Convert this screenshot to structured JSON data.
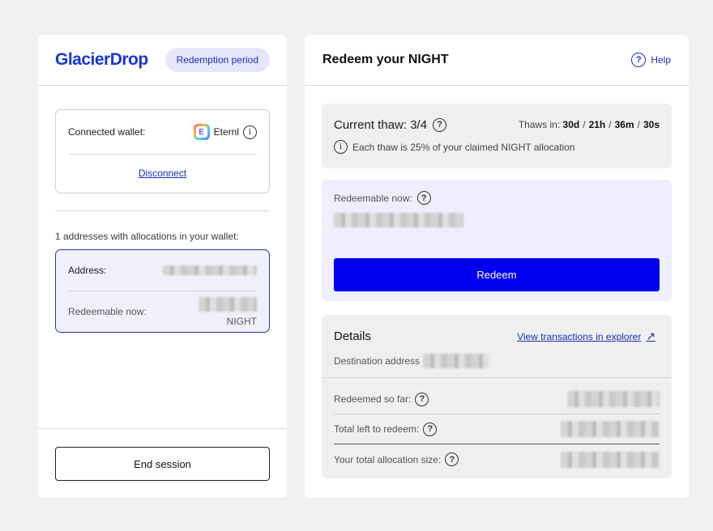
{
  "left": {
    "logo": "GlacierDrop",
    "phase_pill": "Redemption period",
    "wallet": {
      "label": "Connected wallet:",
      "name": "Eternl",
      "disconnect": "Disconnect"
    },
    "alloc_caption": "1 addresses with allocations in your wallet:",
    "address_card": {
      "address_label": "Address:",
      "redeemable_label": "Redeemable now:",
      "unit": "NIGHT"
    },
    "end_session": "End session"
  },
  "right": {
    "title": "Redeem your NIGHT",
    "help": "Help",
    "thaw": {
      "label": "Current thaw: 3/4",
      "timer_label": "Thaws in:",
      "days": "30d",
      "hours": "21h",
      "minutes": "36m",
      "seconds": "30s",
      "separator": "/",
      "note": "Each thaw is 25% of your claimed NIGHT allocation"
    },
    "redeem": {
      "label": "Redeemable now:",
      "button": "Redeem"
    },
    "details": {
      "title": "Details",
      "explorer_link": "View transactions in explorer",
      "destination_label": "Destination address",
      "rows": [
        {
          "label": "Redeemed so far:"
        },
        {
          "label": "Total left to redeem:"
        },
        {
          "label": "Your total allocation size:"
        }
      ]
    }
  },
  "colors": {
    "accent": "#0000f0",
    "brand": "#1836d8",
    "link": "#1b2fb5",
    "pill_bg": "#e6e6fa",
    "selected_card_bg": "#f0f0fb"
  },
  "icons": {
    "help": "question-circle-icon",
    "info": "info-circle-icon",
    "external": "arrow-up-right-icon",
    "wallet": "eternl-logo-icon"
  }
}
